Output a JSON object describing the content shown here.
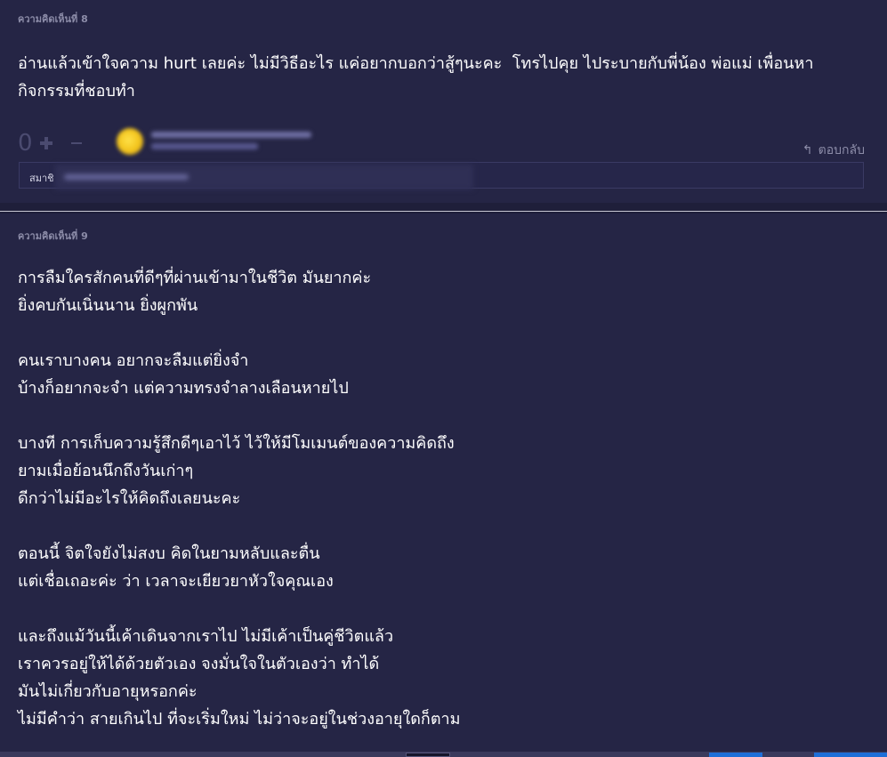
{
  "comment8": {
    "label": "ความคิดเห็นที่ 8",
    "text": "อ่านแล้วเข้าใจความ hurt เลยค่ะ ไม่มีวิธีอะไร แค่อยากบอกว่าสู้ๆนะคะ  โทรไปคุย ไประบายกับพี่น้อง พ่อแม่ เพื่อนหา\nกิจกรรมที่ชอบทำ",
    "votes": "0",
    "reply_label": "ตอบกลับ",
    "member_label": "สมาชิ",
    "icons": {
      "vote_plus": "plus-icon",
      "vote_emoji": "emoji-icon",
      "reply": "reply-arrow-icon"
    },
    "avatar_color": "#f2c21a"
  },
  "comment9": {
    "label": "ความคิดเห็นที่ 9",
    "text": "การลืมใครสักคนที่ดีๆที่ผ่านเข้ามาในชีวิต มันยากค่ะ\nยิ่งคบกันเนิ่นนาน ยิ่งผูกพัน\n\nคนเราบางคน อยากจะลืมแต่ยิ่งจำ\nบ้างก็อยากจะจำ แต่ความทรงจำลางเลือนหายไป\n\nบางที การเก็บความรู้สึกดีๆเอาไว้ ไว้ให้มีโมเมนต์ของความคิดถึง\nยามเมื่อย้อนนึกถึงวันเก่าๆ\nดีกว่าไม่มีอะไรให้คิดถึงเลยนะคะ\n\nตอนนี้ จิตใจยังไม่สงบ คิดในยามหลับและตื่น\nแต่เชื่อเถอะค่ะ ว่า เวลาจะเยียวยาหัวใจคุณเอง\n\nและถึงแม้วันนี้เค้าเดินจากเราไป ไม่มีเค้าเป็นคู่ชีวิตแล้ว\nเราควรอยู่ให้ได้ด้วยตัวเอง จงมั่นใจในตัวเองว่า ทำได้\nมันไม่เกี่ยวกับอายุหรอกค่ะ\nไม่มีคำว่า สายเกินไป ที่จะเริ่มใหม่ ไม่ว่าจะอยู่ในช่วงอายุใดก็ตาม"
  },
  "colors": {
    "background": "#252545",
    "label": "#8c8ca8",
    "text": "#ffffff",
    "accent": "#1e6fd8"
  }
}
